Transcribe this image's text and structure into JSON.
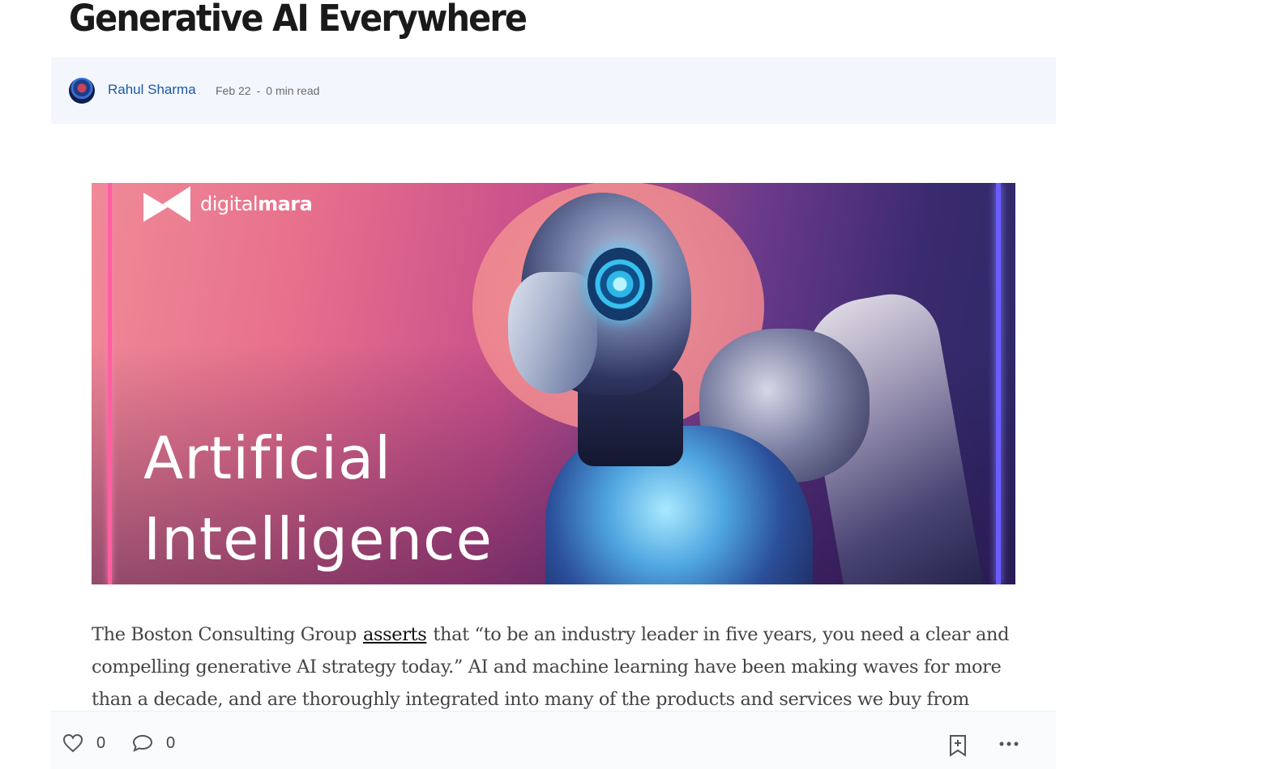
{
  "post": {
    "title": "Generative AI Everywhere",
    "author": "Rahul Sharma",
    "date": "Feb 22",
    "separator": "-",
    "read_time": "0 min read"
  },
  "hero_image": {
    "logo_text_light": "digital",
    "logo_text_bold": "mara",
    "headline_line1": "Artificial",
    "headline_line2": "Intelligence"
  },
  "body": {
    "text_before_link": "The Boston Consulting Group",
    "link_text": "asserts",
    "text_after_link": "that “to be an industry leader in five years, you need a clear and compelling generative AI strategy today.” AI and machine learning have been making waves for more than a decade, and are thoroughly integrated into many of the products and services we buy from major"
  },
  "actions": {
    "likes": "0",
    "comments": "0"
  }
}
